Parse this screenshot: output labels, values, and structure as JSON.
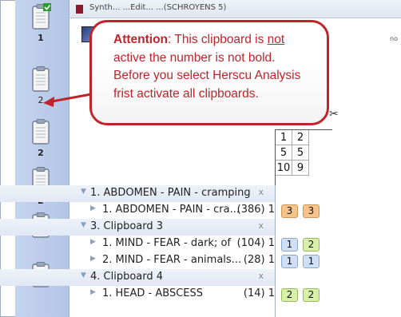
{
  "clipboards": [
    {
      "number": "1",
      "bold": true,
      "icon": "clipboard-checked-icon"
    },
    {
      "number": "2",
      "bold": false,
      "icon": "clipboard-icon"
    },
    {
      "number": "2",
      "bold": true,
      "icon": "clipboard-icon"
    },
    {
      "number": "2",
      "bold": true,
      "icon": "clipboard-icon"
    },
    {
      "number": "",
      "bold": false,
      "icon": "clipboard-icon"
    },
    {
      "number": "",
      "bold": false,
      "icon": "clipboard-icon"
    }
  ],
  "window": {
    "title": "Synth...  ...Edit...  ...(SCHROYENS 5)",
    "tiny_label": "no"
  },
  "grid": {
    "rows": [
      [
        "1",
        "2"
      ],
      [
        "5",
        "5"
      ],
      [
        "10",
        "9"
      ]
    ]
  },
  "callout": {
    "prefix": "Attention",
    "line1_rest": ":  This clipboard is ",
    "underlined": "not",
    "line2": "active the number is not bold.",
    "line3": "Before you select Herscu Analysis",
    "line4": "frist activate all clipboards."
  },
  "tree": [
    {
      "type": "group",
      "label": "1. ABDOMEN - PAIN - cramping",
      "close": "x"
    },
    {
      "type": "item",
      "label": "1. ABDOMEN - PAIN - cra...",
      "count": "(386) 1",
      "grades": [
        {
          "v": "3",
          "c": "orange"
        },
        {
          "v": "3",
          "c": "orange"
        }
      ]
    },
    {
      "type": "group",
      "label": "3. Clipboard 3",
      "close": "x"
    },
    {
      "type": "item",
      "label": "1. MIND - FEAR - dark; of",
      "count": "(104) 1",
      "grades": [
        {
          "v": "1",
          "c": "blue"
        },
        {
          "v": "2",
          "c": "green"
        }
      ]
    },
    {
      "type": "item",
      "label": "2. MIND - FEAR - animals...",
      "count": "(28) 1",
      "grades": [
        {
          "v": "1",
          "c": "blue"
        },
        {
          "v": "1",
          "c": "blue"
        }
      ]
    },
    {
      "type": "group",
      "label": "4. Clipboard 4",
      "close": "x"
    },
    {
      "type": "item",
      "label": "1. HEAD - ABSCESS",
      "count": "(14) 1",
      "grades": [
        {
          "v": "2",
          "c": "green"
        },
        {
          "v": "2",
          "c": "green"
        }
      ]
    }
  ],
  "colors": {
    "callout_red": "#c0242b",
    "strip_blue": "#b8cae9"
  }
}
